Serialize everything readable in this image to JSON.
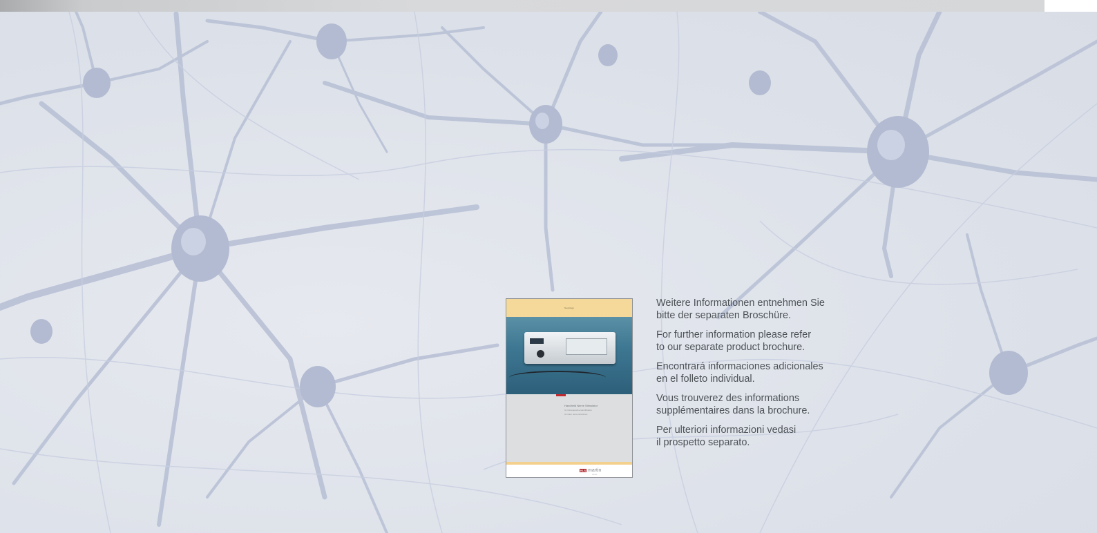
{
  "brochure": {
    "header_text": "Neurology",
    "title_line_1": "Handheld Nerve Stimulator",
    "title_line_2": "for intraoperative identification",
    "title_line_3": "of motor nerve structures",
    "logo_mark": "KLS",
    "logo_text": "martin",
    "logo_subtext": "GROUP"
  },
  "info_paragraphs": [
    "Weitere Informationen entnehmen Sie\nbitte der separaten Broschüre.",
    "For further information please refer\nto our separate product brochure.",
    "Encontrará informaciones adicionales\nen el folleto individual.",
    "Vous trouverez des informations\nsupplémentaires dans la brochure.",
    "Per ulteriori informazioni vedasi\nil prospetto separato."
  ],
  "colors": {
    "background": "#dfe3ea",
    "neuron": "#b7bfd6",
    "brochure_header": "#f5d99b",
    "brochure_accent": "#c4282f",
    "text": "#4d5257"
  },
  "icons": {
    "background_image": "neuron-network-illustration",
    "brochure_image": "nerve-stimulator-device-photo"
  }
}
